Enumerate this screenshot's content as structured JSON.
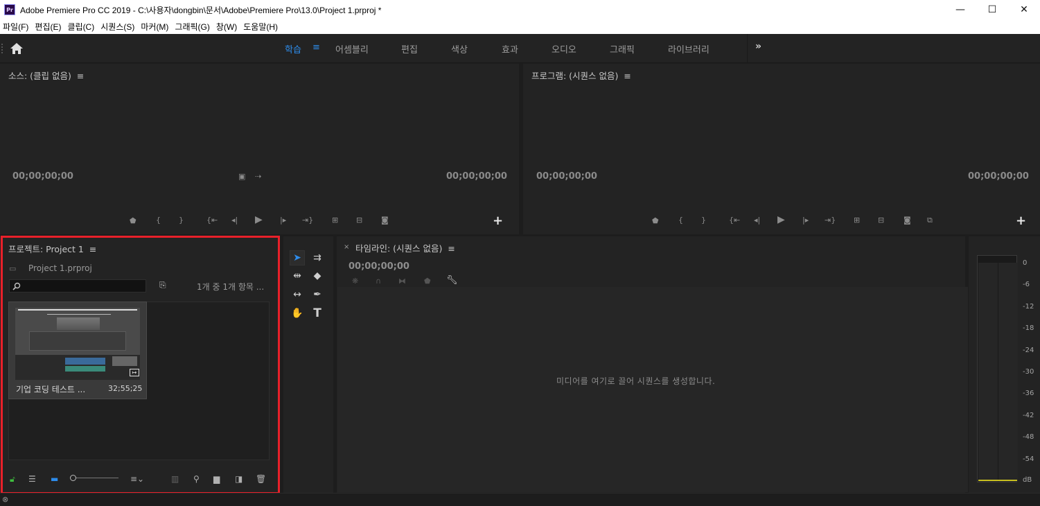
{
  "window": {
    "title": "Adobe Premiere Pro CC 2019 - C:\\사용자\\dongbin\\문서\\Adobe\\Premiere Pro\\13.0\\Project 1.prproj *",
    "app_icon_text": "Pr",
    "minimize": "—",
    "maximize": "☐",
    "close": "✕"
  },
  "menu": [
    "파일(F)",
    "편집(E)",
    "클립(C)",
    "시퀀스(S)",
    "마커(M)",
    "그래픽(G)",
    "창(W)",
    "도움말(H)"
  ],
  "workspaces": {
    "tabs": [
      "학습",
      "어셈블리",
      "편집",
      "색상",
      "효과",
      "오디오",
      "그래픽",
      "라이브러리"
    ],
    "active": "학습",
    "more": "»"
  },
  "source_monitor": {
    "title": "소스: (클립 없음)",
    "timecode_left": "00;00;00;00",
    "timecode_right": "00;00;00;00"
  },
  "program_monitor": {
    "title": "프로그램: (시퀀스 없음)",
    "timecode_left": "00;00;00;00",
    "timecode_right": "00;00;00;00"
  },
  "project": {
    "title": "프로젝트: Project 1",
    "file": "Project 1.prproj",
    "search_placeholder": "",
    "item_count": "1개 중 1개 항목 ...",
    "clip": {
      "name": "기업 코딩 테스트 ...",
      "duration": "32;55;25"
    }
  },
  "timeline": {
    "title": "타임라인: (시퀀스 없음)",
    "timecode": "00;00;00;00",
    "empty_message": "미디어를 여기로 끌어 시퀀스를 생성합니다."
  },
  "audio_meter": {
    "scale": [
      "0",
      "-6",
      "-12",
      "-18",
      "-24",
      "-30",
      "-36",
      "-42",
      "-48",
      "-54",
      "dB"
    ]
  },
  "icons": [
    "home-icon",
    "search-icon",
    "wrench-icon",
    "camera-icon",
    "trash-icon",
    "folder-icon",
    "lock-icon"
  ],
  "colors": {
    "accent": "#2d8ceb",
    "highlight_border": "#e8202a",
    "lock_green": "#3fbf3f"
  }
}
